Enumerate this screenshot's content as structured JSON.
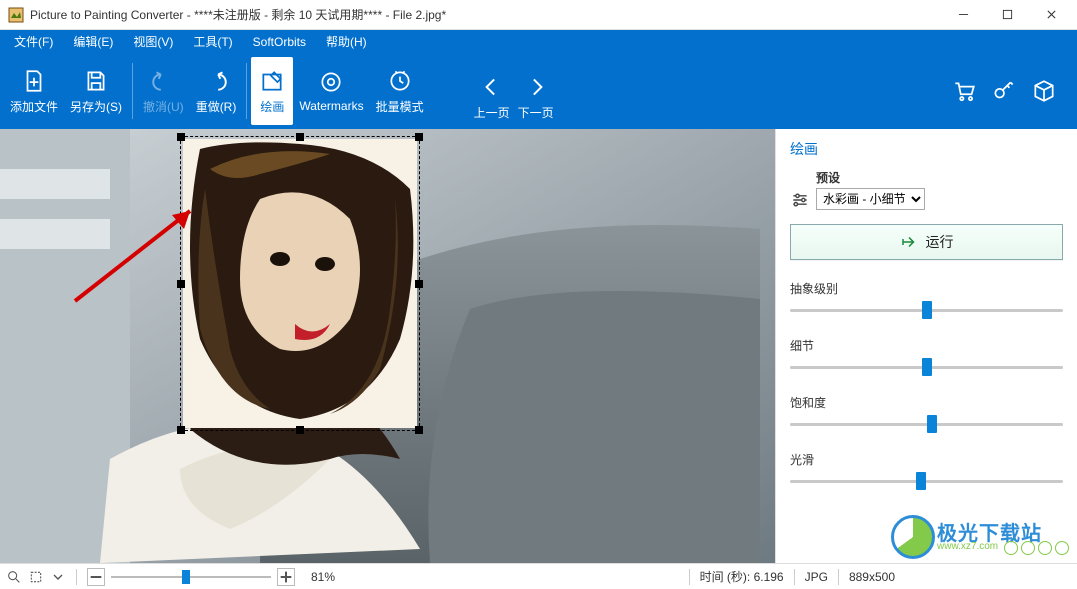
{
  "window": {
    "title": "Picture to Painting Converter - ****未注册版 - 剩余 10 天试用期**** - File 2.jpg*"
  },
  "menu": {
    "file": "文件(F)",
    "edit": "编辑(E)",
    "view": "视图(V)",
    "tools": "工具(T)",
    "softorbits": "SoftOrbits",
    "help": "帮助(H)"
  },
  "toolbar": {
    "add_file": "添加文件",
    "save_as": "另存为(S)",
    "undo": "撤消(U)",
    "redo": "重做(R)",
    "painting": "绘画",
    "watermarks": "Watermarks",
    "batch": "批量模式",
    "prev": "上一页",
    "next": "下一页"
  },
  "panel": {
    "title": "绘画",
    "preset_label": "预设",
    "preset_value": "水彩画 - 小细节",
    "run": "运行",
    "sliders": {
      "abstract": {
        "label": "抽象级别",
        "value": 50
      },
      "detail": {
        "label": "细节",
        "value": 50
      },
      "saturate": {
        "label": "饱和度",
        "value": 52
      },
      "smooth": {
        "label": "光滑",
        "value": 48
      }
    }
  },
  "status": {
    "zoom_pct": "81%",
    "zoom_slider": 47,
    "time_label": "时间 (秒): 6.196",
    "format": "JPG",
    "dims": "889x500"
  },
  "watermark": {
    "text": "极光下载站",
    "url": "www.xz7.com"
  }
}
